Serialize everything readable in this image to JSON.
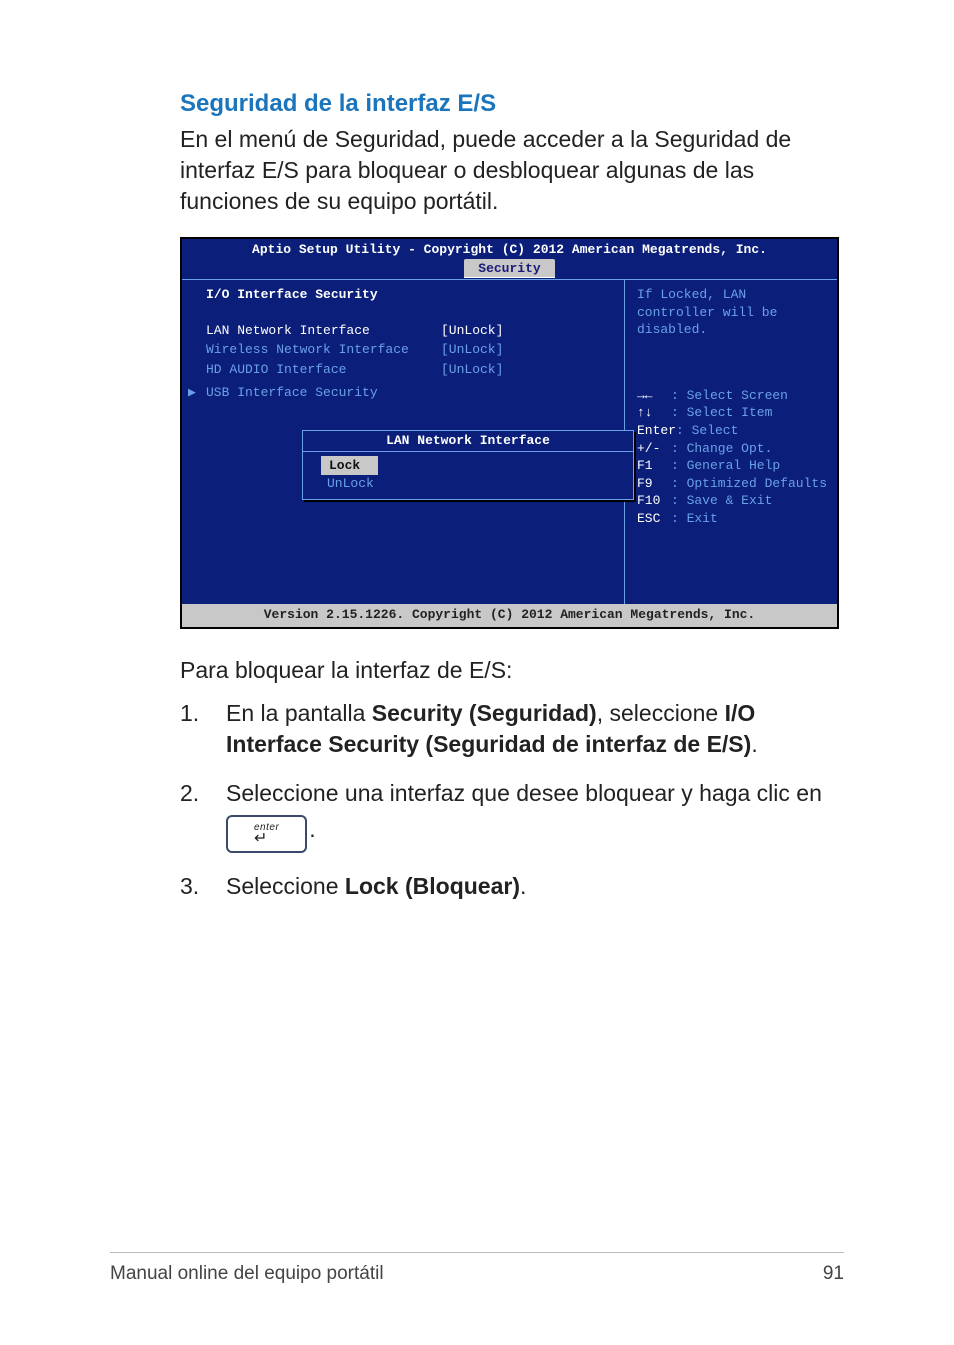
{
  "heading": "Seguridad de la interfaz E/S",
  "intro": "En el menú de Seguridad, puede acceder a la Seguridad de interfaz E/S para bloquear o desbloquear algunas de las funciones de su equipo portátil.",
  "bios": {
    "title": "Aptio Setup Utility - Copyright (C) 2012 American Megatrends, Inc.",
    "tab": "Security",
    "section_title": "I/O Interface Security",
    "items": [
      {
        "label": "LAN Network Interface",
        "value": "[UnLock]",
        "selected": true
      },
      {
        "label": "Wireless Network Interface",
        "value": "[UnLock]",
        "selected": false
      },
      {
        "label": "HD AUDIO Interface",
        "value": "[UnLock]",
        "selected": false
      },
      {
        "label": "USB Interface Security",
        "value": "",
        "selected": false,
        "submenu": true
      }
    ],
    "popup": {
      "title": "LAN Network Interface",
      "options": [
        {
          "label": "Lock",
          "selected": true
        },
        {
          "label": "UnLock",
          "selected": false
        }
      ]
    },
    "help_text": "If Locked, LAN controller will be disabled.",
    "keys": [
      {
        "k": "→←",
        "d": ": Select Screen"
      },
      {
        "k": "↑↓",
        "d": ": Select Item"
      },
      {
        "k": "Enter",
        "d": ": Select"
      },
      {
        "k": "+/-",
        "d": ": Change Opt."
      },
      {
        "k": "F1",
        "d": ": General Help"
      },
      {
        "k": "F9",
        "d": ": Optimized Defaults"
      },
      {
        "k": "F10",
        "d": ": Save & Exit"
      },
      {
        "k": "ESC",
        "d": ": Exit"
      }
    ],
    "footer": "Version 2.15.1226. Copyright (C) 2012 American Megatrends, Inc."
  },
  "after_text": "Para bloquear la interfaz de E/S:",
  "steps": {
    "s1_pre": "En la pantalla ",
    "s1_b1": "Security (Seguridad)",
    "s1_mid": ", seleccione ",
    "s1_b2": "I/O Interface Security (Seguridad de interfaz de E/S)",
    "s1_post": ".",
    "s2": "Seleccione una interfaz que desee bloquear y haga clic en",
    "s2_key_label": "enter",
    "s2_key_glyph": "↵",
    "s2_post": ".",
    "s3_pre": "Seleccione ",
    "s3_b": "Lock (Bloquear)",
    "s3_post": "."
  },
  "step_nums": {
    "n1": "1.",
    "n2": "2.",
    "n3": "3."
  },
  "footer": {
    "left": "Manual online del equipo portátil",
    "right": "91"
  }
}
